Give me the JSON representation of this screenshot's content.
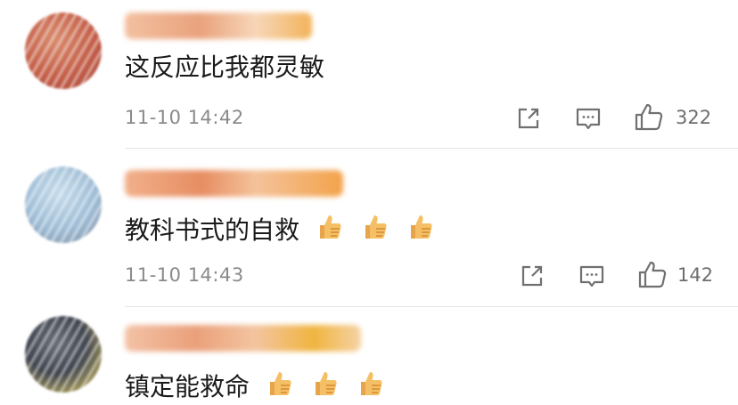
{
  "comments": [
    {
      "text": "这反应比我都灵敏",
      "time": "11-10 14:42",
      "likes": "322",
      "thumb_emoji_count": 0,
      "avatar_colors": [
        "#c86a50",
        "#b44a3c"
      ]
    },
    {
      "text": "教科书式的自救",
      "time": "11-10 14:43",
      "likes": "142",
      "thumb_emoji_count": 3,
      "avatar_colors": [
        "#a9c6de",
        "#7f9ab4"
      ]
    },
    {
      "text": "镇定能救命",
      "time": "",
      "likes": "",
      "thumb_emoji_count": 3,
      "avatar_colors": [
        "#4b4f5a",
        "#c9b35a"
      ]
    }
  ],
  "colors": {
    "text": "#1a1a1a",
    "meta": "#8a8a8a",
    "icon": "#707070",
    "divider": "#e6e6e6",
    "name_blur": "#f0a86a"
  },
  "icons": [
    "share-icon",
    "comment-icon",
    "like-icon",
    "thumbs-up-emoji"
  ]
}
